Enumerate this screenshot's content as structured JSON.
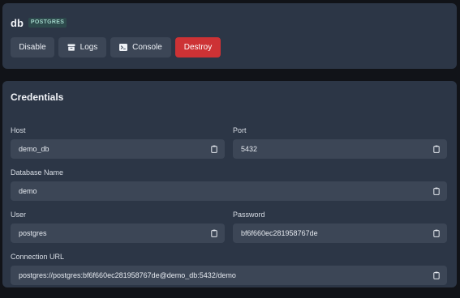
{
  "header": {
    "name": "db",
    "badge": "POSTGRES"
  },
  "actions": {
    "disable": "Disable",
    "logs": "Logs",
    "console": "Console",
    "destroy": "Destroy"
  },
  "credentials": {
    "title": "Credentials",
    "host": {
      "label": "Host",
      "value": "demo_db"
    },
    "port": {
      "label": "Port",
      "value": "5432"
    },
    "database": {
      "label": "Database Name",
      "value": "demo"
    },
    "user": {
      "label": "User",
      "value": "postgres"
    },
    "password": {
      "label": "Password",
      "value": "bf6f660ec281958767de"
    },
    "connection_url": {
      "label": "Connection URL",
      "value": "postgres://postgres:bf6f660ec281958767de@demo_db:5432/demo"
    }
  },
  "icons": {
    "logs": "archive-box-icon",
    "console": "terminal-icon",
    "copy": "clipboard-copy-icon"
  },
  "colors": {
    "card": "#2c3646",
    "field": "#3c4656",
    "destroy": "#cd3235",
    "badge_text": "#9fd3c7"
  }
}
